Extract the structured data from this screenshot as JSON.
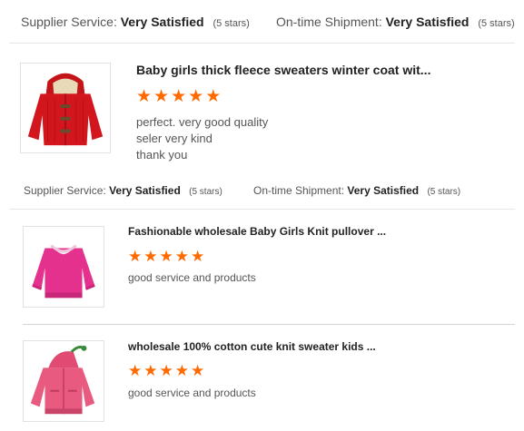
{
  "ratings": [
    {
      "supplier_label": "Supplier Service:",
      "supplier_value": "Very Satisfied",
      "supplier_stars": "(5 stars)",
      "shipment_label": "On-time Shipment:",
      "shipment_value": "Very Satisfied",
      "shipment_stars": "(5 stars)"
    },
    {
      "supplier_label": "Supplier Service:",
      "supplier_value": "Very Satisfied",
      "supplier_stars": "(5 stars)",
      "shipment_label": "On-time Shipment:",
      "shipment_value": "Very Satisfied",
      "shipment_stars": "(5 stars)"
    }
  ],
  "reviews": [
    {
      "title": "Baby girls thick fleece sweaters winter coat wit...",
      "stars": 5,
      "comment": "perfect. very good quality\n seler very kind\nthank you",
      "image": "red-hooded-sweater"
    },
    {
      "title": "Fashionable wholesale Baby Girls Knit pullover ...",
      "stars": 5,
      "comment": "good service and products",
      "image": "pink-pullover"
    },
    {
      "title": "wholesale 100% cotton cute knit sweater kids ...",
      "stars": 5,
      "comment": "good service and products",
      "image": "pink-hooded-sweater"
    }
  ],
  "colors": {
    "star": "#ff6a00",
    "divider": "#e6e6e6"
  }
}
